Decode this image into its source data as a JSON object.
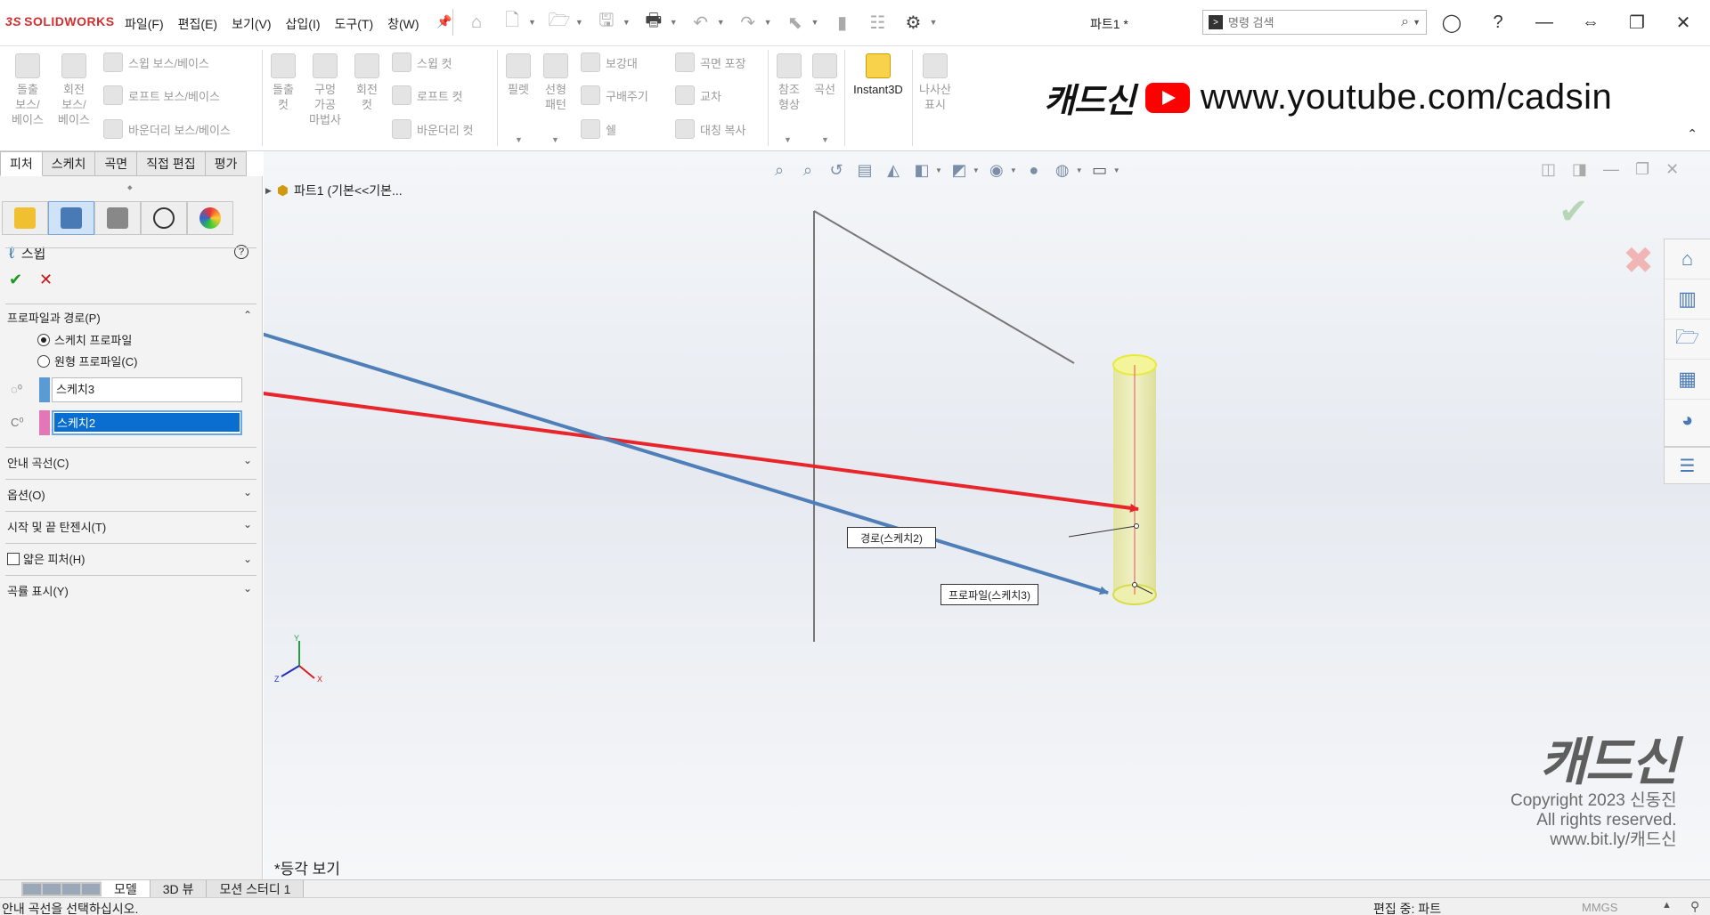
{
  "app": {
    "logo_prefix": "3S",
    "logo_text": "SOLIDWORKS",
    "doc_title": "파트1 *"
  },
  "menu": [
    "파일(F)",
    "편집(E)",
    "보기(V)",
    "삽입(I)",
    "도구(T)",
    "창(W)"
  ],
  "search": {
    "placeholder": "명령 검색"
  },
  "ribbon": {
    "big": [
      {
        "label": "돌출\n보스/\n베이스"
      },
      {
        "label": "회전\n보스/\n베이스"
      },
      {
        "label": "돌출\n컷"
      },
      {
        "label": "구멍\n가공\n마법사"
      },
      {
        "label": "회전\n컷"
      },
      {
        "label": "필렛"
      },
      {
        "label": "선형\n패턴"
      },
      {
        "label": "참조\n형상"
      },
      {
        "label": "곡선"
      },
      {
        "label": "Instant3D"
      },
      {
        "label": "나사산\n표시"
      }
    ],
    "small": [
      "스윕 보스/베이스",
      "로프트 보스/베이스",
      "바운더리 보스/베이스",
      "스윕 컷",
      "로프트 컷",
      "바운더리 컷",
      "보강대",
      "구배주기",
      "쉘",
      "곡면 포장",
      "교차",
      "대칭 복사"
    ]
  },
  "banner": {
    "brand": "캐드신",
    "url": "www.youtube.com/cadsin"
  },
  "tabs": [
    "피처",
    "스케치",
    "곡면",
    "직접 편집",
    "평가"
  ],
  "property_manager": {
    "title": "스윕",
    "help": "?",
    "groups": {
      "profile_path": "프로파일과 경로(P)",
      "guide_curves": "안내 곡선(C)",
      "options": "옵션(O)",
      "tangency": "시작 및 끝 탄젠시(T)",
      "thin_feature": "얇은 피처(H)",
      "curvature": "곡률 표시(Y)"
    },
    "radio_sketch_profile": "스케치 프로파일",
    "radio_circular_profile": "원형 프로파일(C)",
    "profile_value": "스케치3",
    "path_value": "스케치2"
  },
  "viewport": {
    "tree_label": "파트1  (기본<<기본...",
    "view_name": "*등각 보기",
    "callout_path": "경로(스케치2)",
    "callout_profile": "프로파일(스케치3)",
    "axis_labels": {
      "x": "X",
      "y": "Y",
      "z": "Z"
    }
  },
  "watermark": {
    "brand": "캐드신",
    "line1": "Copyright 2023 신동진",
    "line2": "All rights reserved.",
    "line3": "www.bit.ly/캐드신"
  },
  "bottom_tabs": [
    "모델",
    "3D 뷰",
    "모션 스터디 1"
  ],
  "status": {
    "message": "안내 곡선을 선택하십시오.",
    "editing": "편집 중: 파트",
    "units": "MMGS",
    "up": "▲"
  },
  "colors": {
    "accent_blue": "#0a6ed1",
    "profile_swatch": "#5b9bd5",
    "path_swatch": "#e377b6",
    "arrow_red": "#e8252b",
    "arrow_blue": "#4f7fb8",
    "body_yellow": "#eef0b0"
  },
  "icons": [
    "home-icon",
    "new-icon",
    "open-icon",
    "save-icon",
    "print-icon",
    "undo-icon",
    "redo-icon",
    "select-icon",
    "rebuild-icon",
    "file-props-icon",
    "options-gear-icon"
  ]
}
